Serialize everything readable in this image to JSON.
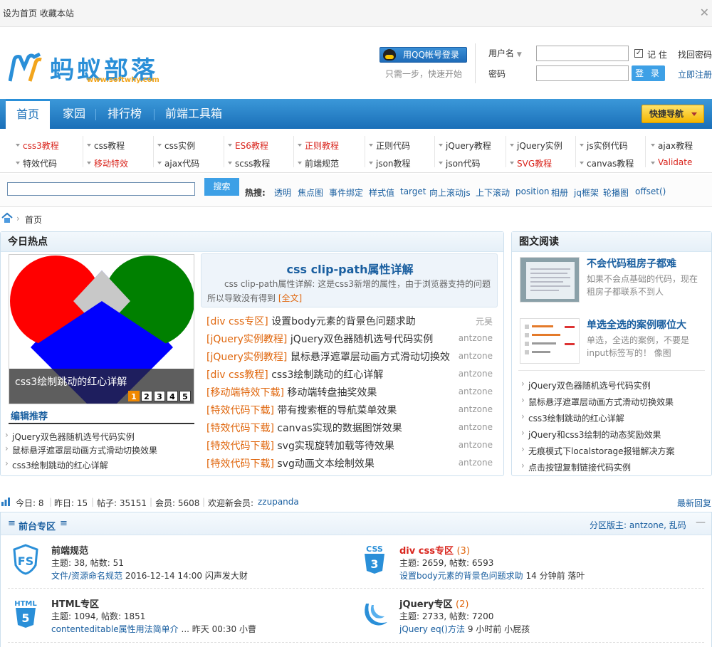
{
  "topbar": {
    "links_text": "设为首页 收藏本站"
  },
  "header": {
    "logo_text": "蚂蚁部落",
    "logo_url": "www.softwhy.com",
    "qq_button": "用QQ帐号登录",
    "qq_sub": "只需一步，快速开始",
    "username_label": "用户名",
    "password_label": "密码",
    "remember_label": "记 住",
    "login_button": "登 录",
    "forgot_link": "找回密码",
    "register_link": "立即注册"
  },
  "nav": {
    "items": [
      "首页",
      "家园",
      "排行榜",
      "前端工具箱"
    ],
    "quick_nav": "快捷导航"
  },
  "subnav": {
    "row1": [
      {
        "label": "css3教程",
        "red": true
      },
      {
        "label": "css教程",
        "red": false
      },
      {
        "label": "css实例",
        "red": false
      },
      {
        "label": "ES6教程",
        "red": true
      },
      {
        "label": "正则教程",
        "red": true
      },
      {
        "label": "正则代码",
        "red": false
      },
      {
        "label": "jQuery教程",
        "red": false
      },
      {
        "label": "jQuery实例",
        "red": false
      },
      {
        "label": "js实例代码",
        "red": false
      },
      {
        "label": "ajax教程",
        "red": false
      }
    ],
    "row2": [
      {
        "label": "特效代码",
        "red": false
      },
      {
        "label": "移动特效",
        "red": true
      },
      {
        "label": "ajax代码",
        "red": false
      },
      {
        "label": "scss教程",
        "red": false
      },
      {
        "label": "前端规范",
        "red": false
      },
      {
        "label": "json教程",
        "red": false
      },
      {
        "label": "json代码",
        "red": false
      },
      {
        "label": "SVG教程",
        "red": true
      },
      {
        "label": "canvas教程",
        "red": false
      },
      {
        "label": "Validate",
        "red": true
      }
    ]
  },
  "search": {
    "button": "搜索",
    "hot_label": "热搜:",
    "hot_words": [
      "透明",
      "焦点图",
      "事件绑定",
      "样式值",
      "target",
      "向上滚动js",
      "上下滚动",
      "position",
      "相册",
      "jq框架",
      "轮播图",
      "offset()"
    ]
  },
  "breadcrumb": {
    "home": "首页"
  },
  "today_hot": {
    "title": "今日热点",
    "slide_caption": "css3绘制跳动的红心详解",
    "pages": [
      "1",
      "2",
      "3",
      "4",
      "5"
    ],
    "editor_title": "编辑推荐",
    "editor_items": [
      "jQuery双色器随机选号代码实例",
      "鼠标悬浮遮罩层动画方式滑动切换效果",
      "css3绘制跳动的红心详解"
    ],
    "featured_title": "css clip-path属性详解",
    "featured_desc": "css clip-path属性详解: 这是css3新增的属性，由于浏览器支持的问题所以导致没有得到",
    "featured_more": "[全文]",
    "news": [
      {
        "tag": "[div css专区]",
        "title": "设置body元素的背景色问题求助",
        "author": "元昊"
      },
      {
        "tag": "[jQuery实例教程]",
        "title": "jQuery双色器随机选号代码实例",
        "author": "antzone"
      },
      {
        "tag": "[jQuery实例教程]",
        "title": "鼠标悬浮遮罩层动画方式滑动切换效",
        "author": "antzone"
      },
      {
        "tag": "[div css教程]",
        "title": "css3绘制跳动的红心详解",
        "author": "antzone"
      },
      {
        "tag": "[移动端特效下载]",
        "title": "移动端转盘抽奖效果",
        "author": "antzone"
      },
      {
        "tag": "[特效代码下载]",
        "title": "带有搜索框的导航菜单效果",
        "author": "antzone"
      },
      {
        "tag": "[特效代码下载]",
        "title": "canvas实现的数据图饼效果",
        "author": "antzone"
      },
      {
        "tag": "[特效代码下载]",
        "title": "svg实现旋转加载等待效果",
        "author": "antzone"
      },
      {
        "tag": "[特效代码下载]",
        "title": "svg动画文本绘制效果",
        "author": "antzone"
      }
    ]
  },
  "picture_read": {
    "title": "图文阅读",
    "items": [
      {
        "title": "不会代码租房子都难",
        "desc": "如果不会点基础的代码，现在租房子都联系不到人"
      },
      {
        "title": "单选全选的案例哪位大",
        "desc": "单选，全选的案例，不要是input标签写的！ 像图"
      }
    ],
    "list": [
      "jQuery双色器随机选号代码实例",
      "鼠标悬浮遮罩层动画方式滑动切换效果",
      "css3绘制跳动的红心详解",
      "jQuery和css3绘制的动态奖励效果",
      "无痕模式下localstorage报错解决方案",
      "点击按钮复制链接代码实例"
    ]
  },
  "stats": {
    "today": "今日: 8",
    "yesterday": "昨日: 15",
    "posts": "帖子: 35151",
    "members": "会员: 5608",
    "welcome": "欢迎新会员:",
    "new_member": "zzupanda",
    "latest_reply": "最新回复"
  },
  "forum": {
    "section_title": "前台专区",
    "moderator_label": "分区版主:",
    "moderators": "antzone, 乱码",
    "boards": [
      {
        "name": "前端规范",
        "count": "",
        "meta": "主题: 38, 帖数: 51",
        "last_link": "文件/资源命名规范",
        "last_time": "2016-12-14 14:00 闪声发大财",
        "icon_text": "FS"
      },
      {
        "name": "div css专区",
        "count": "(3)",
        "meta": "主题: 2659, 帖数: 6593",
        "last_link": "设置body元素的背景色问题求助",
        "last_time": "14 分钟前 落叶",
        "icon_text": "CSS"
      },
      {
        "name": "HTML专区",
        "count": "",
        "meta": "主题: 1094, 帖数: 1851",
        "last_link": "contenteditable属性用法简单介",
        "last_time": "... 昨天 00:30 小曹",
        "icon_text": "HTML"
      },
      {
        "name": "jQuery专区",
        "count": "(2)",
        "meta": "主题: 2733, 帖数: 7200",
        "last_link": "jQuery eq()方法",
        "last_time": "9 小时前 小屁孩",
        "icon_text": "JQ"
      }
    ]
  },
  "colors": {
    "brand": "#2a8fd8",
    "nav": "#1a6fb8",
    "accent_orange": "#e0670e",
    "red": "#d9251d",
    "link": "#1a5fa0"
  }
}
